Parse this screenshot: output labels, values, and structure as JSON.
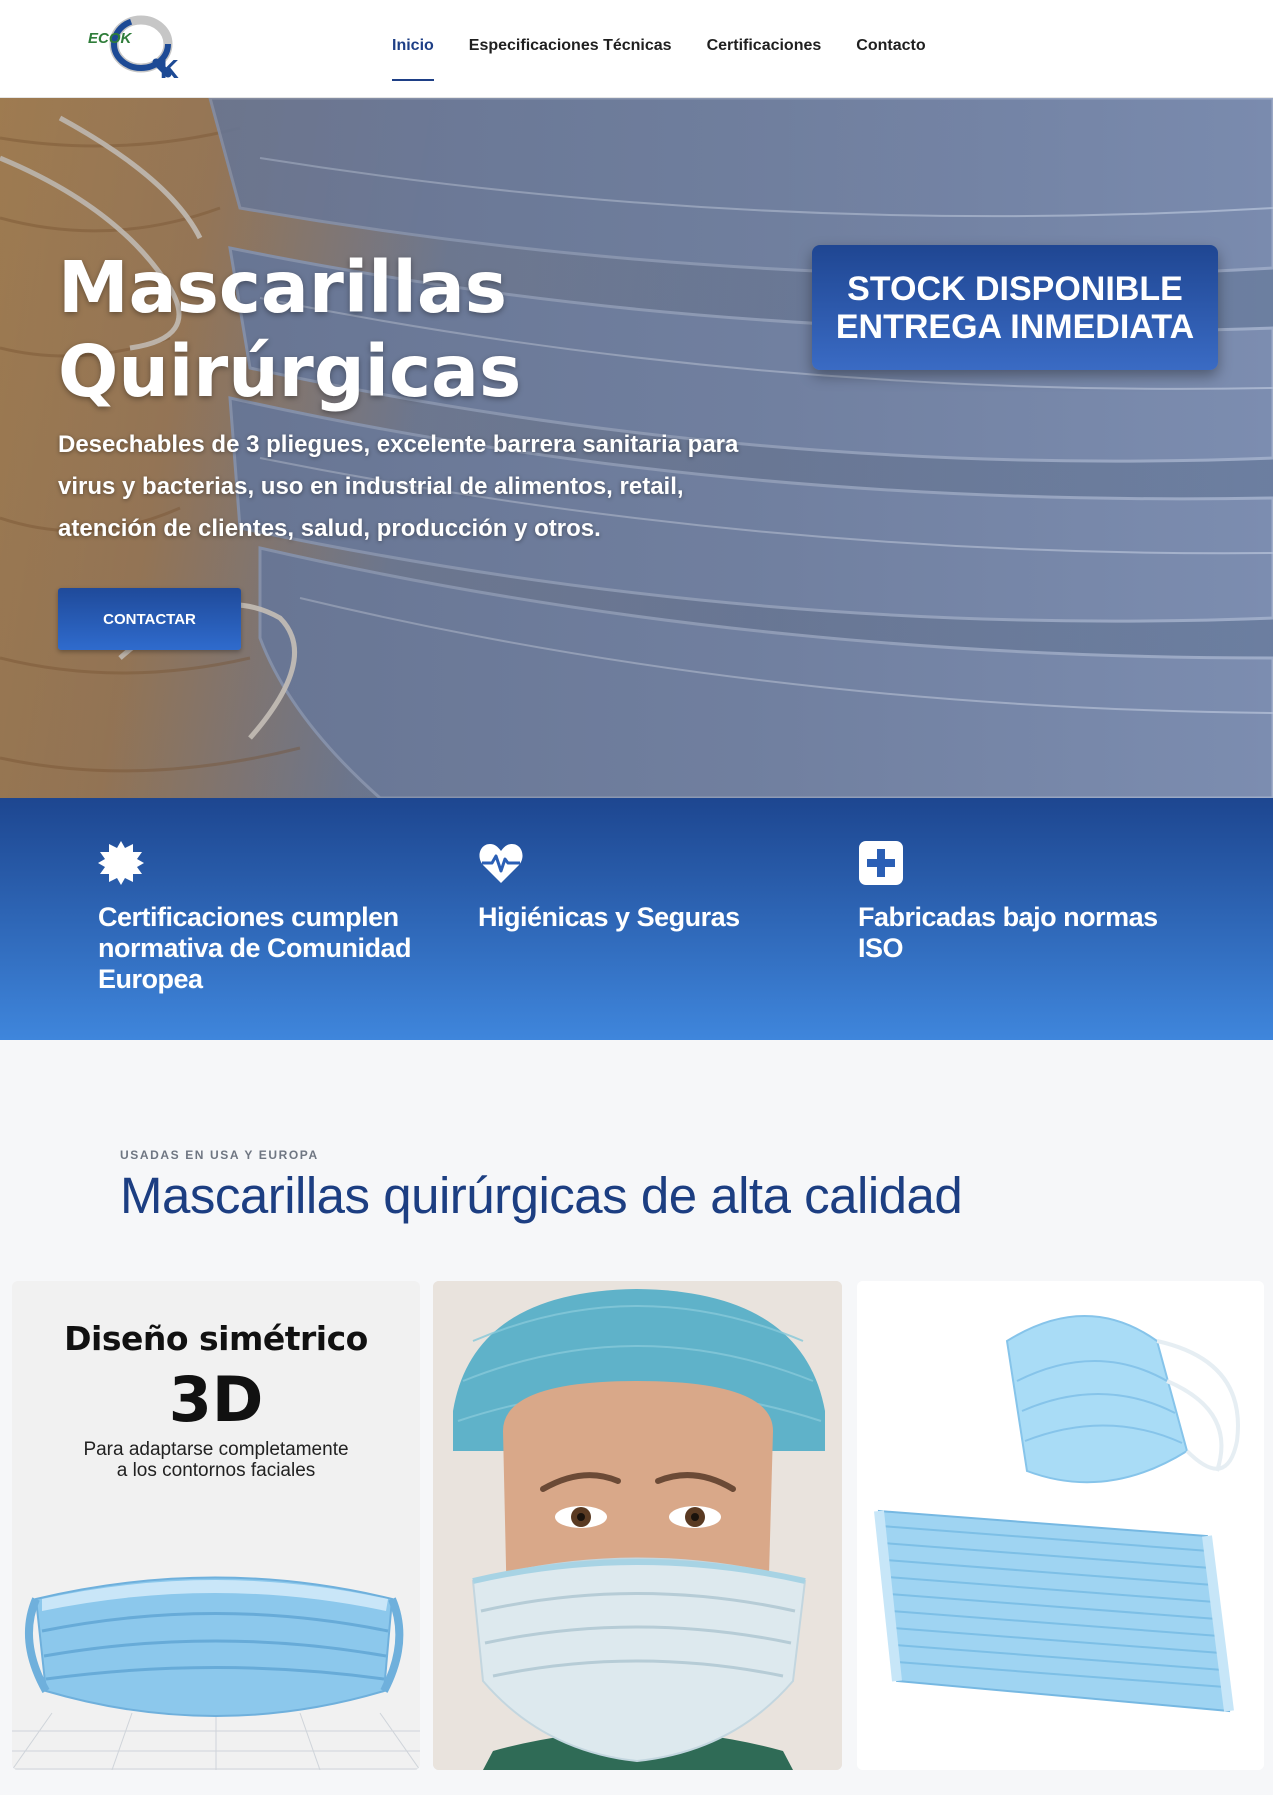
{
  "header": {
    "logo_text": "ECOK",
    "logo_k": "K",
    "nav": [
      {
        "label": "Inicio",
        "active": true
      },
      {
        "label": "Especificaciones Técnicas",
        "active": false
      },
      {
        "label": "Certificaciones",
        "active": false
      },
      {
        "label": "Contacto",
        "active": false
      }
    ]
  },
  "hero": {
    "title_line1": "Mascarillas",
    "title_line2": "Quirúrgicas",
    "description": "Desechables de 3 pliegues, excelente barrera sanitaria para virus y bacterias, uso en industrial de alimentos, retail, atención de clientes, salud, producción y otros.",
    "cta_label": "CONTACTAR",
    "stock_line1": "STOCK DISPONIBLE",
    "stock_line2": "ENTREGA INMEDIATA"
  },
  "features": [
    {
      "icon": "badge-icon",
      "text": "Certificaciones cumplen normativa de Comunidad Europea"
    },
    {
      "icon": "heartbeat-icon",
      "text": "Higiénicas y Seguras"
    },
    {
      "icon": "plus-square-icon",
      "text": "Fabricadas bajo normas ISO"
    }
  ],
  "products": {
    "eyebrow": "USADAS EN USA Y EUROPA",
    "title": "Mascarillas quirúrgicas de alta calidad",
    "card1": {
      "heading": "Diseño simétrico",
      "big": "3D",
      "sub_line1": "Para adaptarse completamente",
      "sub_line2": "a los contornos faciales"
    }
  },
  "colors": {
    "brand_blue": "#1e3f86",
    "band_top": "#1d4690",
    "band_bottom": "#3f86dc",
    "mask_blue": "#8cc8ec",
    "logo_green": "#2f7d3a"
  }
}
